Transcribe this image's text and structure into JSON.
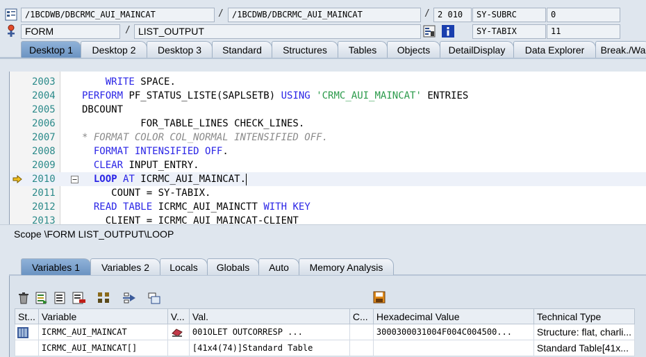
{
  "header": {
    "program1": "/1BCDWB/DBCRMC_AUI_MAINCAT",
    "program2": "/1BCDWB/DBCRMC_AUI_MAINCAT",
    "line_no": "2",
    "line_val": "010",
    "subrc_label": "SY-SUBRC",
    "subrc_value": "0",
    "event_type": "FORM",
    "event_name": "LIST_OUTPUT",
    "tabix_label": "SY-TABIX",
    "tabix_value": "11",
    "slash": "/"
  },
  "desktop_tabs": [
    "Desktop 1",
    "Desktop 2",
    "Desktop 3",
    "Standard",
    "Structures",
    "Tables",
    "Objects",
    "DetailDisplay",
    "Data Explorer",
    "Break./Wa"
  ],
  "source": {
    "lines": [
      {
        "no": "2003",
        "parts": [
          {
            "t": "    ",
            "c": ""
          },
          {
            "t": "WRITE",
            "c": "kw"
          },
          {
            "t": " SPACE.",
            "c": ""
          }
        ]
      },
      {
        "no": "2004",
        "parts": [
          {
            "t": "PERFORM",
            "c": "kw"
          },
          {
            "t": " PF_STATUS_LISTE(SAPLSETB) ",
            "c": ""
          },
          {
            "t": "USING",
            "c": "kw"
          },
          {
            "t": " ",
            "c": ""
          },
          {
            "t": "'CRMC_AUI_MAINCAT'",
            "c": "str"
          },
          {
            "t": " ENTRIES",
            "c": ""
          }
        ]
      },
      {
        "no": "2005",
        "parts": [
          {
            "t": "DBCOUNT",
            "c": ""
          }
        ]
      },
      {
        "no": "2006",
        "parts": [
          {
            "t": "          FOR_TABLE_LINES CHECK_LINES.",
            "c": ""
          }
        ]
      },
      {
        "no": "2007",
        "parts": [
          {
            "t": "* FORMAT COLOR COL_NORMAL INTENSIFIED OFF.",
            "c": "cmt"
          }
        ]
      },
      {
        "no": "2008",
        "parts": [
          {
            "t": "  ",
            "c": ""
          },
          {
            "t": "FORMAT",
            "c": "kw"
          },
          {
            "t": " ",
            "c": ""
          },
          {
            "t": "INTENSIFIED",
            "c": "kw"
          },
          {
            "t": " ",
            "c": ""
          },
          {
            "t": "OFF",
            "c": "kw"
          },
          {
            "t": ".",
            "c": ""
          }
        ]
      },
      {
        "no": "2009",
        "parts": [
          {
            "t": "  ",
            "c": ""
          },
          {
            "t": "CLEAR",
            "c": "kw"
          },
          {
            "t": " INPUT_ENTRY.",
            "c": ""
          }
        ]
      },
      {
        "no": "2010",
        "parts": [
          {
            "t": "  ",
            "c": ""
          },
          {
            "t": "LOOP",
            "c": "kw"
          },
          {
            "t": " ",
            "c": ""
          },
          {
            "t": "AT",
            "c": "kw"
          },
          {
            "t": " ICRMC_AUI_MAINCAT.",
            "c": ""
          }
        ],
        "current": true
      },
      {
        "no": "2011",
        "parts": [
          {
            "t": "     COUNT = SY-TABIX.",
            "c": ""
          }
        ]
      },
      {
        "no": "2012",
        "parts": [
          {
            "t": "  ",
            "c": ""
          },
          {
            "t": "READ",
            "c": "kw"
          },
          {
            "t": " ",
            "c": ""
          },
          {
            "t": "TABLE",
            "c": "kw"
          },
          {
            "t": " ICRMC_AUI_MAINCTT ",
            "c": ""
          },
          {
            "t": "WITH",
            "c": "kw"
          },
          {
            "t": " ",
            "c": ""
          },
          {
            "t": "KEY",
            "c": "kw"
          }
        ]
      },
      {
        "no": "2013",
        "parts": [
          {
            "t": "    CLIENT = ICRMC_AUI_MAINCAT-CLIENT",
            "c": ""
          }
        ]
      }
    ]
  },
  "scope": "Scope \\FORM LIST_OUTPUT\\LOOP",
  "var_tabs": [
    "Variables 1",
    "Variables 2",
    "Locals",
    "Globals",
    "Auto",
    "Memory Analysis"
  ],
  "grid": {
    "headers": [
      "St...",
      "Variable",
      "V...",
      "Val.",
      "C...",
      "Hexadecimal Value",
      "Technical Type"
    ],
    "rows": [
      {
        "variable": "ICRMC_AUI_MAINCAT",
        "value": "001OLET       OUTCORRESP ...",
        "hex": "3000300031004F004C004500...",
        "type": "Structure: flat, charli..."
      },
      {
        "variable": "ICRMC_AUI_MAINCAT[]",
        "value": "[41x4(74)]Standard Table",
        "hex": "",
        "type": "Standard Table[41x..."
      }
    ]
  },
  "colors": {
    "keyword": "#2a24e6",
    "string": "#2a9a4a",
    "comment": "#8a8a8a",
    "line_number": "#2b8a8a",
    "active_tab": "#7ba2cf"
  }
}
